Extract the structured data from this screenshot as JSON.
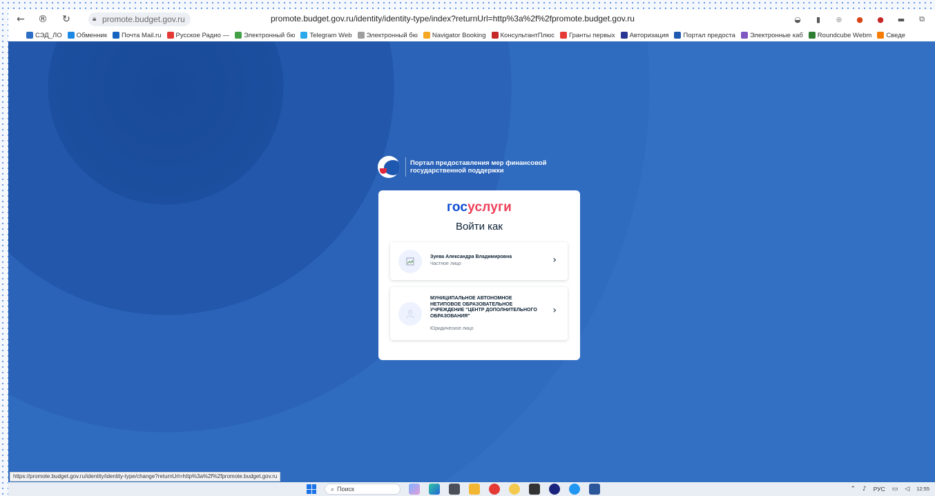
{
  "browser": {
    "domain_chip": "promote.budget.gov.ru",
    "url": "promote.budget.gov.ru/identity/identity-type/index?returnUrl=http%3a%2f%2fpromote.budget.gov.ru"
  },
  "bookmarks": [
    {
      "label": "СЭД_ЛО",
      "color": "#2b6cc4"
    },
    {
      "label": "Обменник",
      "color": "#1e88e5"
    },
    {
      "label": "Почта Mail.ru",
      "color": "#1565c0"
    },
    {
      "label": "Русское Радио —",
      "color": "#e53935"
    },
    {
      "label": "Электронный бю",
      "color": "#43a047"
    },
    {
      "label": "Telegram Web",
      "color": "#29a9eb"
    },
    {
      "label": "Электронный бю",
      "color": "#9e9e9e"
    },
    {
      "label": "Navigator Booking",
      "color": "#f5a623"
    },
    {
      "label": "КонсультантПлюс",
      "color": "#c62828"
    },
    {
      "label": "Гранты первых",
      "color": "#e53935"
    },
    {
      "label": "Авторизация",
      "color": "#283593"
    },
    {
      "label": "Портал предоста",
      "color": "#1f58b0"
    },
    {
      "label": "Электронные каб",
      "color": "#7e57c2"
    },
    {
      "label": "Roundcube Webm",
      "color": "#2e7d32"
    },
    {
      "label": "Сведе",
      "color": "#f57c00"
    }
  ],
  "portal": {
    "title_line1": "Портал предоставления мер финансовой",
    "title_line2": "государственной поддержки"
  },
  "card": {
    "logo_part1": "гос",
    "logo_part2": "услуги",
    "title": "Войти как",
    "accounts": [
      {
        "name": "Зуева Александра Владимировна",
        "kind": "Частное лицо"
      },
      {
        "name_lines": [
          "МУНИЦИПАЛЬНОЕ АВТОНОМНОЕ",
          "НЕТИПОВОЕ ОБРАЗОВАТЕЛЬНОЕ",
          "УЧРЕЖДЕНИЕ \"ЦЕНТР ДОПОЛНИТЕЛЬНОГО",
          "ОБРАЗОВАНИЯ\""
        ],
        "kind": "Юридическое лицо"
      }
    ]
  },
  "status_url": "https://promote.budget.gov.ru/identity/identity-type/change?returnUrl=http%3a%2f%2fpromote.budget.gov.ru",
  "taskbar": {
    "search_label": "Поиск",
    "lang": "РУС",
    "time": "12:55"
  },
  "colors": {
    "gos_blue": "#0d4cd3",
    "gos_red": "#ee3f58",
    "page_bg": "#2a63b8"
  }
}
